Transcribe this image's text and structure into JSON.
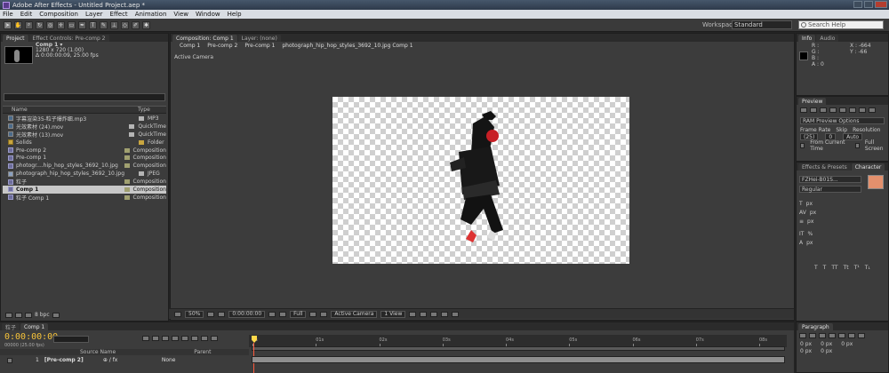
{
  "app": {
    "title": "Adobe After Effects - Untitled Project.aep *"
  },
  "menu": [
    "File",
    "Edit",
    "Composition",
    "Layer",
    "Effect",
    "Animation",
    "View",
    "Window",
    "Help"
  ],
  "toolbar": {
    "workspace_label": "Workspace:",
    "workspace_value": "Standard",
    "search_placeholder": "Search Help"
  },
  "project": {
    "tabs": [
      "Project",
      "Effect Controls: Pre-comp 2"
    ],
    "selected_name": "Comp 1 ▾",
    "selected_info": [
      "1280 x 720 (1.00)",
      "Δ 0:00:00:09, 25.00 fps"
    ],
    "columns": {
      "name": "Name",
      "type": "Type"
    },
    "items": [
      {
        "name": "字幕渲染35-粒子爆炸细.mp3",
        "type": "MP3",
        "kind": "footage",
        "color": "#b5b5b5",
        "indent": false,
        "selected": false
      },
      {
        "name": "光效素材 (24).mov",
        "type": "QuickTime",
        "kind": "footage",
        "color": "#b5b5b5",
        "indent": false,
        "selected": false
      },
      {
        "name": "光效素材 (13).mov",
        "type": "QuickTime",
        "kind": "footage",
        "color": "#b5b5b5",
        "indent": false,
        "selected": false
      },
      {
        "name": "Solids",
        "type": "Folder",
        "kind": "folder",
        "color": "#c9a640",
        "indent": false,
        "selected": false
      },
      {
        "name": "Pre-comp 2",
        "type": "Composition",
        "kind": "comp",
        "color": "#a0a070",
        "indent": false,
        "selected": false
      },
      {
        "name": "Pre-comp 1",
        "type": "Composition",
        "kind": "comp",
        "color": "#a0a070",
        "indent": false,
        "selected": false
      },
      {
        "name": "photogr....hip_hop_styles_3692_10.jpg Comp 1",
        "type": "Composition",
        "kind": "comp",
        "color": "#a0a070",
        "indent": false,
        "selected": false
      },
      {
        "name": "photograph_hip_hop_styles_3692_10.jpg",
        "type": "JPEG",
        "kind": "image",
        "color": "#b5b5b5",
        "indent": false,
        "selected": false
      },
      {
        "name": "粒子",
        "type": "Composition",
        "kind": "comp",
        "color": "#a0a070",
        "indent": false,
        "selected": false
      },
      {
        "name": "Comp 1",
        "type": "Composition",
        "kind": "comp",
        "color": "#a0a070",
        "indent": false,
        "selected": true
      },
      {
        "name": "粒子 Comp 1",
        "type": "Composition",
        "kind": "comp",
        "color": "#a0a070",
        "indent": false,
        "selected": false
      }
    ],
    "bpc": "8 bpc"
  },
  "viewer": {
    "tabs": [
      "Composition: Comp 1",
      "Layer: (none)"
    ],
    "breadcrumbs": [
      "Comp 1",
      "Pre-comp 2",
      "Pre-comp 1",
      "photograph_hip_hop_styles_3692_10.jpg Comp 1"
    ],
    "active_camera": "Active Camera",
    "zoom": "50%",
    "timecode": "0:00:00:00",
    "resolution": "Full",
    "camera_select": "Active Camera",
    "views": "1 View"
  },
  "info": {
    "tabs": [
      "Info",
      "Audio"
    ],
    "labels": [
      "R :",
      "G :",
      "B :",
      "A : 0"
    ],
    "coords": [
      "X : -664",
      "Y : -66"
    ]
  },
  "preview": {
    "title": "Preview",
    "options": "RAM Preview Options",
    "frame_rate_label": "Frame Rate",
    "skip_label": "Skip",
    "resolution_label": "Resolution",
    "frame_rate": "(25)",
    "skip": "0",
    "resolution": "Auto",
    "from_current": "From Current Time",
    "full_screen": "Full Screen"
  },
  "character": {
    "tabs": [
      "Effects & Presets",
      "Character"
    ],
    "font": "FZHei-B01S...",
    "style": "Regular",
    "units": [
      "px",
      "px",
      "px",
      "%",
      "%",
      "px",
      "%"
    ],
    "fill_color": "#e3906d"
  },
  "timeline": {
    "tabs": [
      "粒子",
      "Comp 1"
    ],
    "time": "0:00:00:00",
    "frame_info": "00000 (25.00 fps)",
    "ticks": [
      "0s",
      "01s",
      "02s",
      "03s",
      "04s",
      "05s",
      "06s",
      "07s",
      "08s"
    ],
    "column_source": "Source Name",
    "column_parent": "Parent",
    "layer_num": "1",
    "layer_name": "[Pre-comp 2]",
    "layer_parent": "None"
  },
  "paragraph": {
    "title": "Paragraph",
    "values": [
      "0 px",
      "0 px",
      "0 px",
      "0 px",
      "0 px"
    ]
  }
}
